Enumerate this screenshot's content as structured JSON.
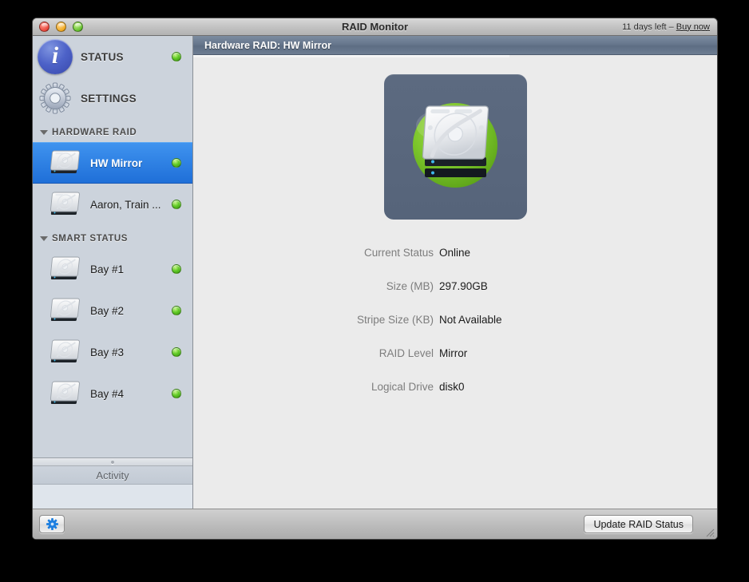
{
  "window": {
    "title": "RAID Monitor",
    "trial_text": "11 days left – ",
    "trial_link": "Buy now",
    "traffic": {
      "close": "close-button",
      "minimize": "minimize-button",
      "zoom": "zoom-button"
    }
  },
  "sidebar": {
    "nav": [
      {
        "label": "STATUS",
        "icon": "info-icon",
        "status": "green"
      },
      {
        "label": "SETTINGS",
        "icon": "gear-icon",
        "status": null
      }
    ],
    "sections": [
      {
        "label": "HARDWARE RAID",
        "expanded": true,
        "items": [
          {
            "label": "HW Mirror",
            "status": "green",
            "selected": true
          },
          {
            "label": "Aaron, Train ...",
            "status": "green",
            "selected": false
          }
        ]
      },
      {
        "label": "SMART STATUS",
        "expanded": true,
        "items": [
          {
            "label": "Bay #1",
            "status": "green",
            "selected": false
          },
          {
            "label": "Bay #2",
            "status": "green",
            "selected": false
          },
          {
            "label": "Bay #3",
            "status": "green",
            "selected": false
          },
          {
            "label": "Bay #4",
            "status": "green",
            "selected": false
          }
        ]
      }
    ],
    "activity_label": "Activity"
  },
  "content": {
    "header": "Hardware RAID: HW Mirror",
    "hero_icon": "raid-volume-icon",
    "details": [
      {
        "label": "Current Status",
        "value": "Online"
      },
      {
        "label": "Size (MB)",
        "value": "297.90GB"
      },
      {
        "label": "Stripe Size (KB)",
        "value": "Not Available"
      },
      {
        "label": "RAID Level",
        "value": "Mirror"
      },
      {
        "label": "Logical Drive",
        "value": "disk0"
      }
    ]
  },
  "bottombar": {
    "action_icon": "gear-action-icon",
    "update_label": "Update RAID Status"
  },
  "colors": {
    "accent_selection": "#1f6fd8",
    "status_green": "#63cc28",
    "header_slate": "#66768c",
    "hero_bg": "#56647a"
  }
}
